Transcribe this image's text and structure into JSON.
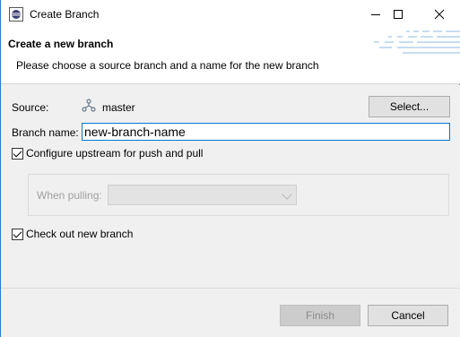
{
  "window": {
    "title": "Create Branch"
  },
  "banner": {
    "title": "Create a new branch",
    "message": "Please choose a source branch and a name for the new branch"
  },
  "form": {
    "source_label": "Source:",
    "source_value": "master",
    "select_label": "Select...",
    "branch_name_label": "Branch name:",
    "branch_name_value": "new-branch-name",
    "configure_upstream_label": "Configure upstream for push and pull",
    "configure_upstream_checked": true,
    "when_pulling_label": "When pulling:",
    "when_pulling_value": "",
    "checkout_label": "Check out new branch",
    "checkout_checked": true
  },
  "footer": {
    "finish_label": "Finish",
    "cancel_label": "Cancel"
  },
  "colors": {
    "accent": "#0078d7",
    "window_border": "#2b7bd0",
    "disabled_text": "#8c8c8c"
  }
}
